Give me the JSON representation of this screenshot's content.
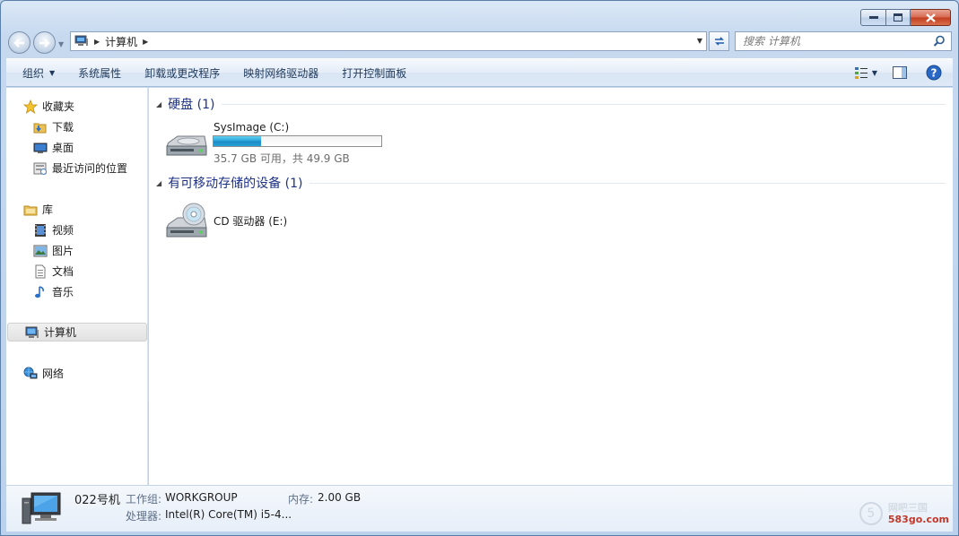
{
  "window": {
    "caption_buttons": {
      "minimize": "minimize-icon",
      "maximize": "maximize-icon",
      "close": "close-icon"
    }
  },
  "address": {
    "location_icon": "computer-icon",
    "crumb": "计算机",
    "search_placeholder": "搜索 计算机"
  },
  "command_bar": {
    "organize": "组织",
    "system_properties": "系统属性",
    "uninstall": "卸载或更改程序",
    "map_drive": "映射网络驱动器",
    "control_panel": "打开控制面板"
  },
  "nav": {
    "favorites": "收藏夹",
    "downloads": "下载",
    "desktop": "桌面",
    "recent": "最近访问的位置",
    "libraries": "库",
    "videos": "视频",
    "pictures": "图片",
    "documents": "文档",
    "music": "音乐",
    "computer": "计算机",
    "network": "网络"
  },
  "content": {
    "hard_disks_header": "硬盘 (1)",
    "removable_header": "有可移动存储的设备 (1)",
    "drive_c": {
      "label": "SysImage (C:)",
      "free_text": "35.7 GB 可用，共 49.9 GB",
      "used_fraction": 0.285
    },
    "drive_e": {
      "label": "CD 驱动器 (E:)"
    }
  },
  "details": {
    "name": "022号机",
    "workgroup_label": "工作组:",
    "workgroup_value": "WORKGROUP",
    "memory_label": "内存:",
    "memory_value": "2.00 GB",
    "processor_label": "处理器:",
    "processor_value": "Intel(R) Core(TM) i5-4..."
  },
  "watermark": {
    "line1": "网吧三国",
    "line2": "583go.com",
    "glyph": "5"
  },
  "colors": {
    "accent": "#26a0da",
    "header_text": "#1e3287"
  }
}
